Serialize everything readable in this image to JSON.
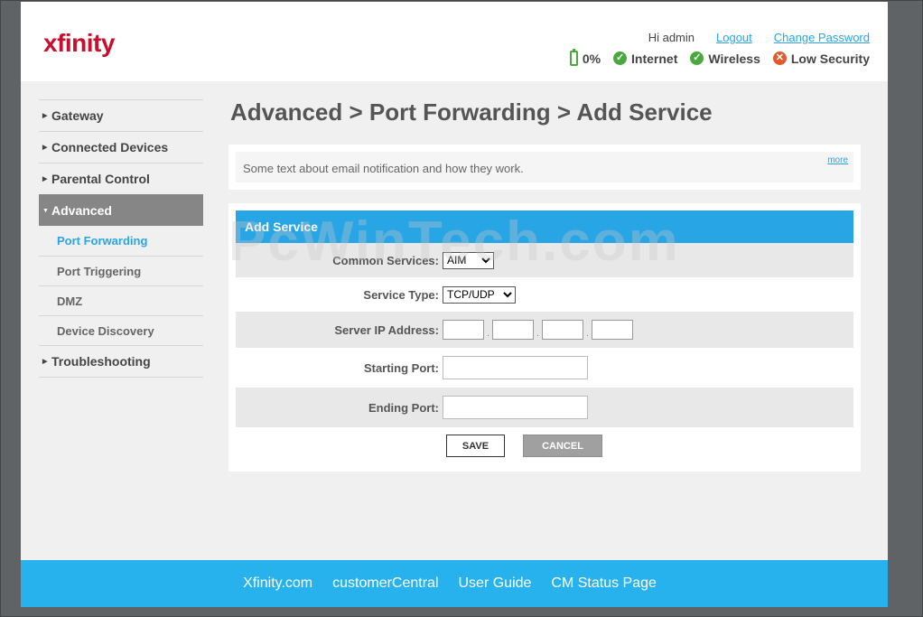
{
  "header": {
    "logo": "xfinity",
    "greeting": "Hi admin",
    "logout_label": "Logout",
    "change_password_label": "Change Password",
    "status": {
      "battery": "0%",
      "internet": "Internet",
      "wireless": "Wireless",
      "security": "Low Security"
    }
  },
  "sidebar": {
    "gateway": "Gateway",
    "connected_devices": "Connected Devices",
    "parental_control": "Parental Control",
    "advanced": "Advanced",
    "sub_items": [
      "Port Forwarding",
      "Port Triggering",
      "DMZ",
      "Device Discovery"
    ],
    "troubleshooting": "Troubleshooting"
  },
  "main": {
    "title": "Advanced > Port Forwarding > Add Service",
    "notice_text": "Some text about email notification and how they work.",
    "more_label": "more",
    "form": {
      "header": "Add Service",
      "common_services_label": "Common Services:",
      "common_services_value": "AIM",
      "service_type_label": "Service Type:",
      "service_type_value": "TCP/UDP",
      "server_ip_label": "Server IP Address:",
      "starting_port_label": "Starting Port:",
      "ending_port_label": "Ending Port:",
      "save_label": "SAVE",
      "cancel_label": "CANCEL"
    }
  },
  "footer": {
    "links": [
      "Xfinity.com",
      "customerCentral",
      "User Guide",
      "CM Status Page"
    ]
  },
  "watermark": "PcWinTech.com",
  "colors": {
    "brand": "#c8102e",
    "accent": "#27a5e5",
    "ok": "#4aa93c",
    "error": "#e25a2b"
  }
}
